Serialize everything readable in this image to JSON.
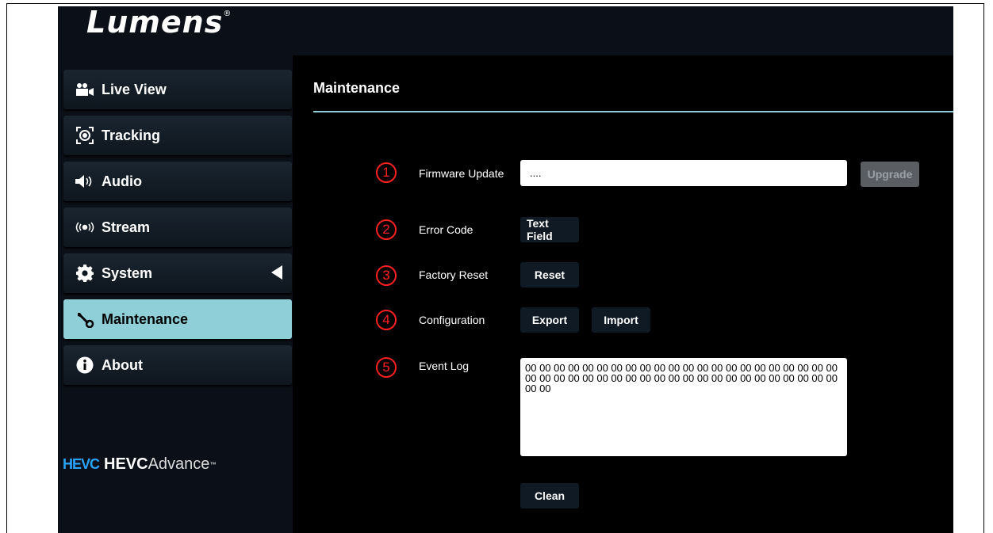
{
  "brand": {
    "logo": "Lumens",
    "logo_mark": "®"
  },
  "sidebar": {
    "items": [
      {
        "label": "Live View",
        "icon": "video-camera-icon"
      },
      {
        "label": "Tracking",
        "icon": "tracking-icon"
      },
      {
        "label": "Audio",
        "icon": "speaker-icon"
      },
      {
        "label": "Stream",
        "icon": "stream-icon"
      },
      {
        "label": "System",
        "icon": "gear-icon"
      },
      {
        "label": "Maintenance",
        "icon": "wrench-icon",
        "active": true
      },
      {
        "label": "About",
        "icon": "info-icon"
      }
    ],
    "footer": {
      "mark": "HEVC",
      "bold": "HEVC",
      "thin": "Advance",
      "tm": "™"
    }
  },
  "main": {
    "title": "Maintenance",
    "markers": [
      "1",
      "2",
      "3",
      "4",
      "5"
    ],
    "firmware": {
      "label": "Firmware Update",
      "value": "....",
      "button": "Upgrade"
    },
    "error_code": {
      "label": "Error Code",
      "button": "Text Field"
    },
    "factory_reset": {
      "label": "Factory Reset",
      "button": "Reset"
    },
    "configuration": {
      "label": "Configuration",
      "export": "Export",
      "import": "Import"
    },
    "event_log": {
      "label": "Event Log",
      "content": "00 00 00 00 00 00 00 00 00 00 00 00 00 00 00 00 00 00 00 00 00 00 00 00 00 00 00 00 00 00 00 00 00 00 00 00 00 00 00 00 00 00 00 00 00 00",
      "button": "Clean"
    }
  },
  "colors": {
    "accent": "#8ecfd8",
    "marker": "#ff2020",
    "background": "#000000",
    "sidebar": "#0b0f17"
  }
}
